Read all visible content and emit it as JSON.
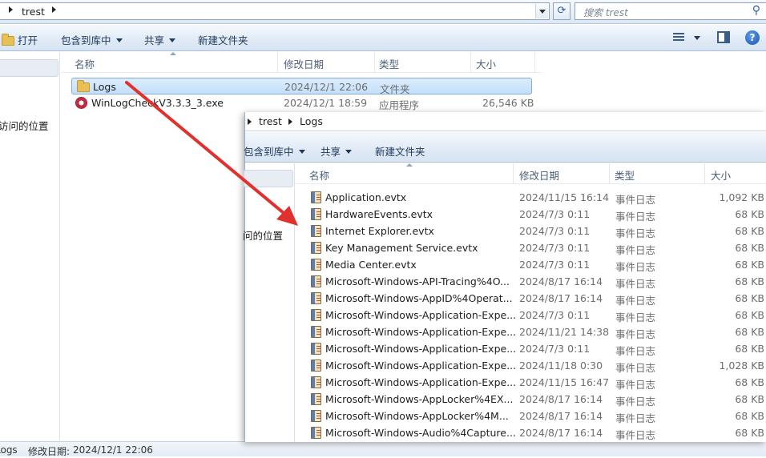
{
  "back_window": {
    "address": {
      "crumb": "trest"
    },
    "search": {
      "placeholder": "搜索 trest"
    },
    "toolbar": {
      "open": "打开",
      "include_library": "包含到库中",
      "share": "共享",
      "new_folder": "新建文件夹"
    },
    "nav": {
      "recent_text": "访问的位置"
    },
    "columns": {
      "name": "名称",
      "modified": "修改日期",
      "type": "类型",
      "size": "大小"
    },
    "rows": [
      {
        "name": "Logs",
        "modified": "2024/12/1 22:06",
        "type": "文件夹",
        "size": "",
        "icon": "folder-icon",
        "selected": true
      },
      {
        "name": "WinLogCheckV3.3.3_3.exe",
        "modified": "2024/12/1 18:59",
        "type": "应用程序",
        "size": "26,546 KB",
        "icon": "app-icon",
        "selected": false
      }
    ],
    "status": {
      "name": "Logs",
      "modified_label": "修改日期:",
      "modified_value": "2024/12/1 22:06"
    }
  },
  "front_window": {
    "address": {
      "crumb1": "trest",
      "crumb2": "Logs"
    },
    "toolbar": {
      "include_library": "包含到库中",
      "share": "共享",
      "new_folder": "新建文件夹"
    },
    "nav": {
      "recent_text": "问的位置"
    },
    "columns": {
      "name": "名称",
      "modified": "修改日期",
      "type": "类型",
      "size": "大小"
    },
    "rows": [
      {
        "name": "Application.evtx",
        "modified": "2024/11/15 16:14",
        "type": "事件日志",
        "size": "1,092 KB"
      },
      {
        "name": "HardwareEvents.evtx",
        "modified": "2024/7/3 0:11",
        "type": "事件日志",
        "size": "68 KB"
      },
      {
        "name": "Internet Explorer.evtx",
        "modified": "2024/7/3 0:11",
        "type": "事件日志",
        "size": "68 KB"
      },
      {
        "name": "Key Management Service.evtx",
        "modified": "2024/7/3 0:11",
        "type": "事件日志",
        "size": "68 KB"
      },
      {
        "name": "Media Center.evtx",
        "modified": "2024/7/3 0:11",
        "type": "事件日志",
        "size": "68 KB"
      },
      {
        "name": "Microsoft-Windows-API-Tracing%4O...",
        "modified": "2024/8/17 16:14",
        "type": "事件日志",
        "size": "68 KB"
      },
      {
        "name": "Microsoft-Windows-AppID%4Operat...",
        "modified": "2024/8/17 16:14",
        "type": "事件日志",
        "size": "68 KB"
      },
      {
        "name": "Microsoft-Windows-Application-Expe...",
        "modified": "2024/7/3 0:11",
        "type": "事件日志",
        "size": "68 KB"
      },
      {
        "name": "Microsoft-Windows-Application-Expe...",
        "modified": "2024/11/21 14:38",
        "type": "事件日志",
        "size": "68 KB"
      },
      {
        "name": "Microsoft-Windows-Application-Expe...",
        "modified": "2024/7/3 0:11",
        "type": "事件日志",
        "size": "68 KB"
      },
      {
        "name": "Microsoft-Windows-Application-Expe...",
        "modified": "2024/11/18 0:30",
        "type": "事件日志",
        "size": "1,028 KB"
      },
      {
        "name": "Microsoft-Windows-Application-Expe...",
        "modified": "2024/11/15 16:47",
        "type": "事件日志",
        "size": "68 KB"
      },
      {
        "name": "Microsoft-Windows-AppLocker%4EX...",
        "modified": "2024/8/17 16:14",
        "type": "事件日志",
        "size": "68 KB"
      },
      {
        "name": "Microsoft-Windows-AppLocker%4M...",
        "modified": "2024/8/17 16:14",
        "type": "事件日志",
        "size": "68 KB"
      },
      {
        "name": "Microsoft-Windows-Audio%4Capture...",
        "modified": "2024/8/17 16:14",
        "type": "事件日志",
        "size": "68 KB"
      }
    ]
  },
  "colors": {
    "arrow": "#e0312e",
    "selection": "#cce4fb"
  }
}
